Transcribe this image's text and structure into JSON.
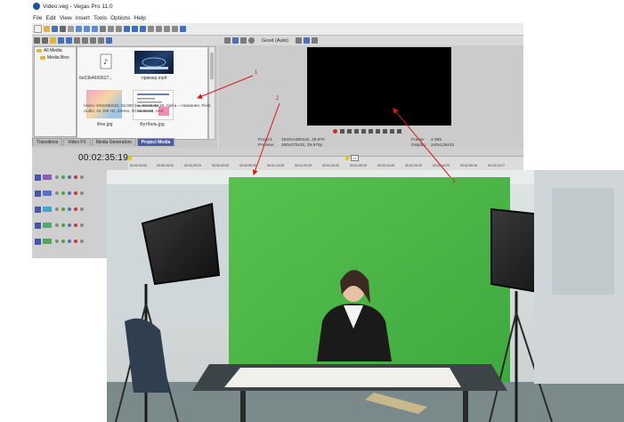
{
  "window": {
    "title": "Video.veg - Vegas Pro 11.0",
    "menu": [
      "File",
      "Edit",
      "View",
      "Insert",
      "Tools",
      "Options",
      "Help"
    ]
  },
  "explorer": {
    "tree": [
      "All Media",
      "Media Bins"
    ],
    "items": [
      {
        "caption": "6e03b4660637..."
      },
      {
        "caption": "пример.mp4"
      },
      {
        "caption": "Фон.jpg"
      },
      {
        "caption": "Футболь.jpg"
      }
    ],
    "properties_line1": "Video: 640x360x32, 25,000 fps, 00:02:38:28, Alpha = Название, Field",
    "properties_line2": "Audio: 44 100 Hz, Stereo, 00:02:38:28, AAC",
    "tabs": [
      "Transitions",
      "Video FX",
      "Media Generators",
      "Project Media"
    ],
    "active_tab": "Project Media"
  },
  "preview": {
    "quality": "Good (Auto)",
    "project_label": "Project:",
    "project_value": "1920x1080x32, 29,970",
    "preview_label": "Preview:",
    "preview_value": "480x270x32, 29,970p",
    "frame_label": "Frame:",
    "frame_value": "4 565",
    "display_label": "Display:",
    "display_value": "240x126x32"
  },
  "timeline": {
    "timecode": "00:02:35:19",
    "marker_label": "+1",
    "ticks": [
      "00:00:00:00",
      "00:00:15:00",
      "00:00:29:29",
      "00:00:44:29",
      "00:00:59:28",
      "00:01:14:28",
      "00:01:29:29",
      "00:01:44:29",
      "00:01:59:28",
      "00:02:14:28",
      "00:02:29:29",
      "00:02:44:29",
      "00:02:59:28",
      "00:03:14:27"
    ]
  },
  "annotations": [
    "1",
    "2",
    "3"
  ],
  "colors": {
    "accent_tab": "#4d5ba0",
    "arrow": "#d41a1a",
    "greenscreen": "#4fb84a",
    "timecode_marker": "#e6c81f"
  }
}
